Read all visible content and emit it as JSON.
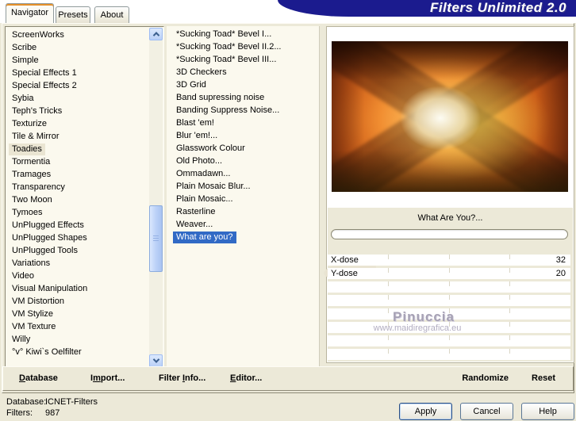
{
  "window": {
    "title": "Filters Unlimited 2.0"
  },
  "tabs": [
    {
      "label": "Navigator",
      "active": true
    },
    {
      "label": "Presets",
      "active": false
    },
    {
      "label": "About",
      "active": false
    }
  ],
  "navigator": {
    "categories": [
      {
        "label": "ScreenWorks"
      },
      {
        "label": "Scribe"
      },
      {
        "label": "Simple"
      },
      {
        "label": "Special Effects 1"
      },
      {
        "label": "Special Effects 2"
      },
      {
        "label": "Sybia"
      },
      {
        "label": "Teph's Tricks"
      },
      {
        "label": "Texturize"
      },
      {
        "label": "Tile & Mirror"
      },
      {
        "label": "Toadies",
        "selected": true
      },
      {
        "label": "Tormentia"
      },
      {
        "label": "Tramages"
      },
      {
        "label": "Transparency"
      },
      {
        "label": "Two Moon"
      },
      {
        "label": "Tymoes"
      },
      {
        "label": "UnPlugged Effects"
      },
      {
        "label": "UnPlugged Shapes"
      },
      {
        "label": "UnPlugged Tools"
      },
      {
        "label": "Variations"
      },
      {
        "label": "Video"
      },
      {
        "label": "Visual Manipulation"
      },
      {
        "label": "VM Distortion"
      },
      {
        "label": "VM Stylize"
      },
      {
        "label": "VM Texture"
      },
      {
        "label": "Willy"
      },
      {
        "label": "°v° Kiwi`s Oelfilter"
      }
    ],
    "filters": [
      {
        "label": "*Sucking Toad*  Bevel I..."
      },
      {
        "label": "*Sucking Toad*  Bevel II.2..."
      },
      {
        "label": "*Sucking Toad*  Bevel III..."
      },
      {
        "label": "3D Checkers"
      },
      {
        "label": "3D Grid"
      },
      {
        "label": "Band supressing noise"
      },
      {
        "label": "Banding Suppress Noise..."
      },
      {
        "label": "Blast 'em!"
      },
      {
        "label": "Blur 'em!..."
      },
      {
        "label": "Glasswork Colour"
      },
      {
        "label": "Old Photo..."
      },
      {
        "label": "Ommadawn..."
      },
      {
        "label": "Plain Mosaic Blur..."
      },
      {
        "label": "Plain Mosaic..."
      },
      {
        "label": "Rasterline"
      },
      {
        "label": "Weaver..."
      },
      {
        "label": "What are you?",
        "selected": true
      }
    ]
  },
  "preview_panel": {
    "filter_title": "What Are You?...",
    "sliders": [
      {
        "label": "X-dose",
        "value": "32"
      },
      {
        "label": "Y-dose",
        "value": "20"
      }
    ],
    "watermark": {
      "line1": "Pinuccia",
      "line2": "www.maidiregrafica.eu"
    }
  },
  "toolbar": {
    "left": [
      {
        "pre": "",
        "key": "D",
        "post": "atabase"
      },
      {
        "pre": "I",
        "key": "m",
        "post": "port..."
      },
      {
        "pre": "Filter ",
        "key": "I",
        "post": "nfo..."
      },
      {
        "pre": "",
        "key": "E",
        "post": "ditor..."
      }
    ],
    "right": [
      "Randomize",
      "Reset"
    ]
  },
  "status": {
    "database_label": "Database:",
    "database_value": "ICNET-Filters",
    "filters_label": "Filters:",
    "filters_value": "987"
  },
  "actions": [
    "Apply",
    "Cancel",
    "Help"
  ],
  "colors": {
    "selection_blue": "#316ac5",
    "banner_navy": "#1b1b8e",
    "tab_accent": "#e5902a",
    "dialog_bg": "#ece9d8"
  }
}
